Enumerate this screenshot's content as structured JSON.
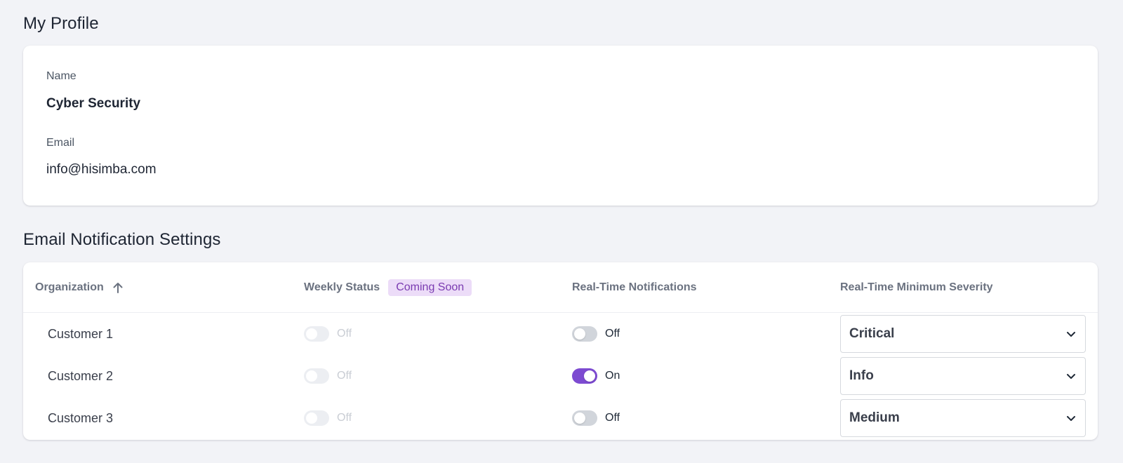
{
  "profile": {
    "title": "My Profile",
    "name_label": "Name",
    "name_value": "Cyber Security",
    "email_label": "Email",
    "email_value": "info@hisimba.com"
  },
  "notifications": {
    "title": "Email Notification Settings",
    "columns": {
      "organization": "Organization",
      "weekly_status": "Weekly Status",
      "coming_soon_badge": "Coming Soon",
      "realtime": "Real-Time Notifications",
      "min_severity": "Real-Time Minimum Severity"
    },
    "rows": [
      {
        "organization": "Customer 1",
        "weekly_status": "Off",
        "realtime": "Off",
        "realtime_on": false,
        "severity": "Critical"
      },
      {
        "organization": "Customer 2",
        "weekly_status": "Off",
        "realtime": "On",
        "realtime_on": true,
        "severity": "Info"
      },
      {
        "organization": "Customer 3",
        "weekly_status": "Off",
        "realtime": "Off",
        "realtime_on": false,
        "severity": "Medium"
      }
    ]
  },
  "colors": {
    "accent": "#7d4bd1",
    "badge_bg": "#ecdcf8",
    "badge_text": "#7a3bb1",
    "page_bg": "#f2f3f7"
  },
  "icons": {
    "sort": "arrow-up-icon",
    "dropdown": "chevron-down-icon"
  }
}
